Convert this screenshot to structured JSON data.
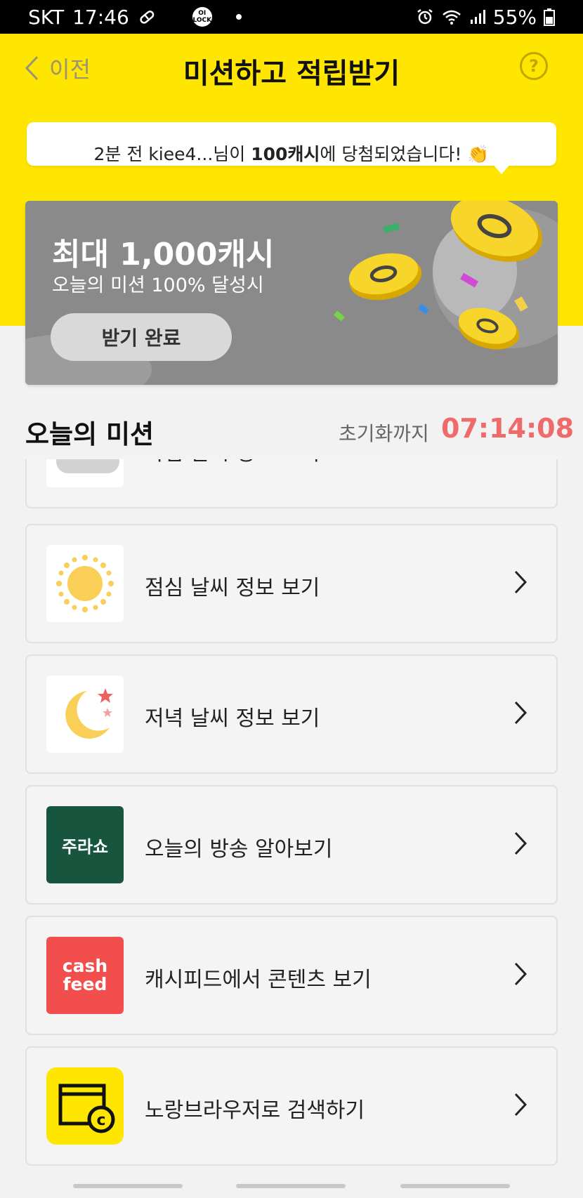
{
  "status_bar": {
    "carrier": "SKT",
    "time": "17:46",
    "lock_badge": "OI LOCK",
    "battery": "55%"
  },
  "header": {
    "back_label": "이전",
    "title": "미션하고 적립받기",
    "help_symbol": "?"
  },
  "ticker": {
    "prefix": "2분 전 kiee4...님이 ",
    "amount": "100캐시",
    "suffix": "에 당첨되었습니다! 👏"
  },
  "banner": {
    "title": "최대 1,000캐시",
    "subtitle": "오늘의 미션 100% 달성시",
    "button_label": "받기 완료"
  },
  "missions_section": {
    "title": "오늘의 미션",
    "reset_label": "초기화까지",
    "reset_timer": "07:14:08"
  },
  "missions": [
    {
      "label": "아침 날씨 정보 보기",
      "icon": "cloud-icon"
    },
    {
      "label": "점심 날씨 정보 보기",
      "icon": "sun-icon"
    },
    {
      "label": "저녁 날씨 정보 보기",
      "icon": "moon-stars-icon"
    },
    {
      "label": "오늘의 방송 알아보기",
      "icon": "jurasho-logo",
      "logo_text": "주라쇼"
    },
    {
      "label": "캐시피드에서 콘텐츠 보기",
      "icon": "cashfeed-logo",
      "logo_text_1": "cash",
      "logo_text_2": "feed"
    },
    {
      "label": "노랑브라우저로 검색하기",
      "icon": "yellow-browser-icon"
    }
  ],
  "colors": {
    "brand_yellow": "#ffe600",
    "timer_red": "#ef6b6b",
    "banner_gray": "#8a8a8a",
    "jurasho_green": "#17553f",
    "cashfeed_red": "#f24e4e"
  }
}
